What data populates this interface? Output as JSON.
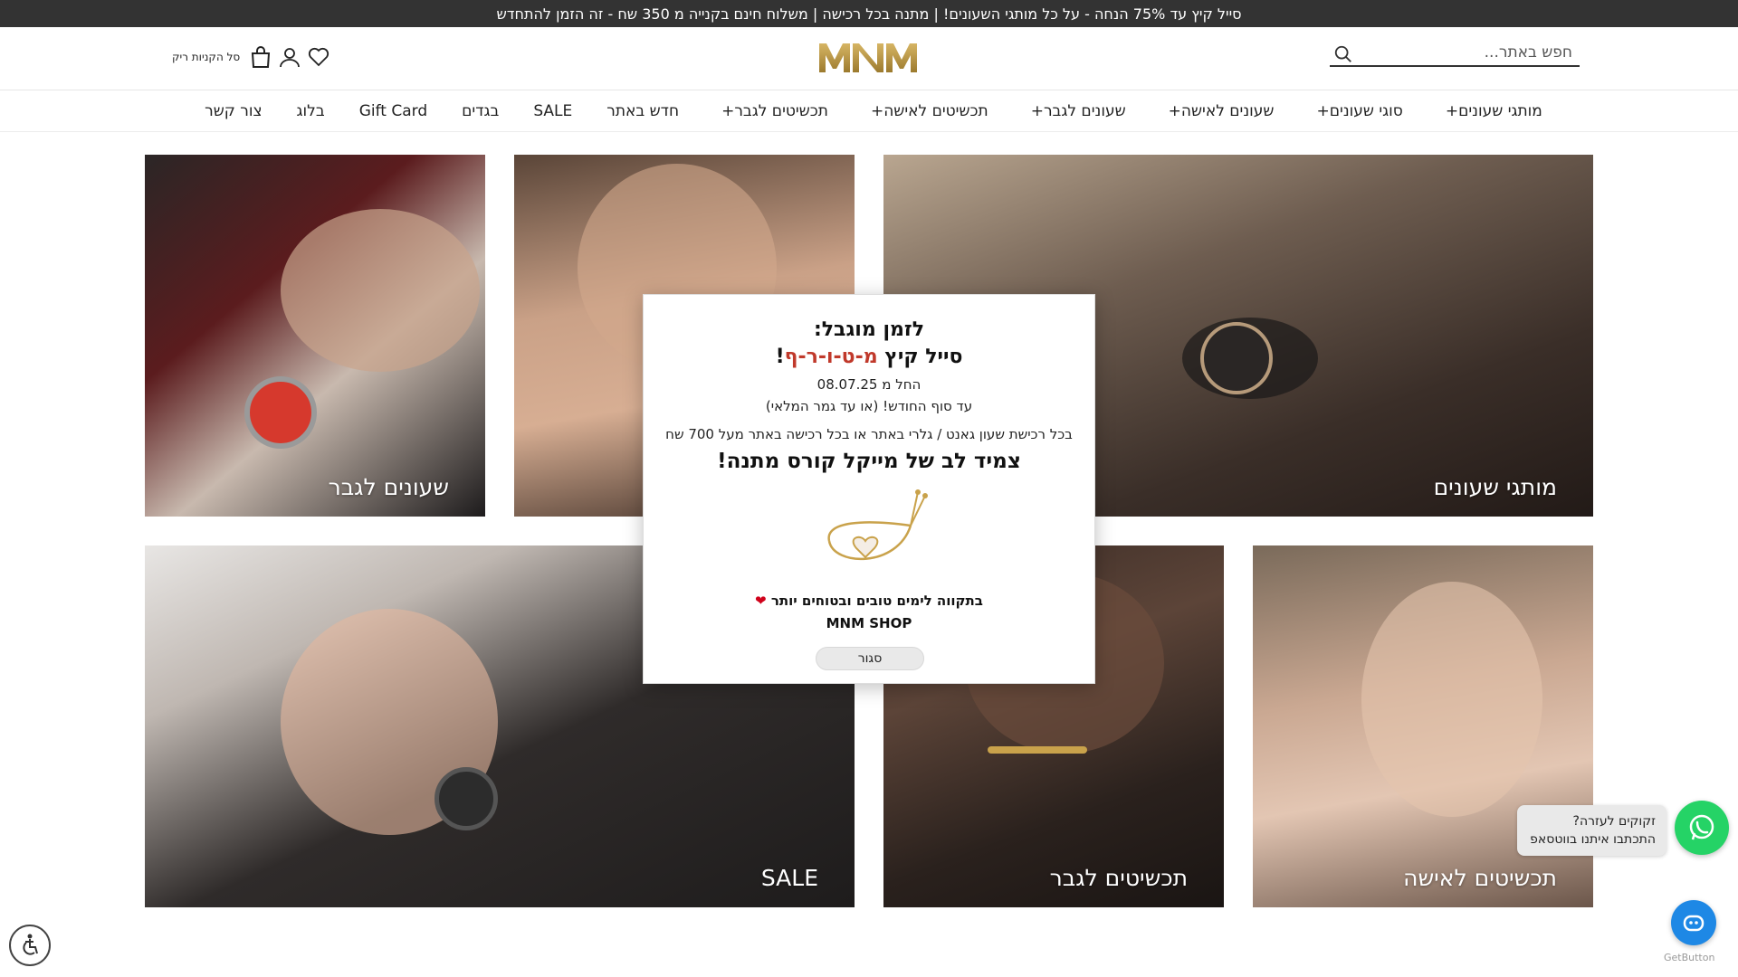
{
  "announcement": "סייל קיץ עד 75% הנחה - על כל מותגי השעונים! | מתנה בכל רכישה | משלוח חינם בקנייה מ 350 שח - זה הזמן להתחדש",
  "header": {
    "search_placeholder": "חפש באתר...",
    "logo_text": "MNM",
    "cart_text": "סל הקניות ריק"
  },
  "nav": {
    "items": [
      {
        "label": "מותגי שעונים",
        "has_plus": true
      },
      {
        "label": "סוגי שעונים",
        "has_plus": true
      },
      {
        "label": "שעונים לאישה",
        "has_plus": true
      },
      {
        "label": "שעונים לגבר",
        "has_plus": true
      },
      {
        "label": "תכשיטים לאישה",
        "has_plus": true
      },
      {
        "label": "תכשיטים לגבר",
        "has_plus": true
      },
      {
        "label": "חדש באתר",
        "has_plus": false
      },
      {
        "label": "SALE",
        "has_plus": false
      },
      {
        "label": "בגדים",
        "has_plus": false
      },
      {
        "label": "Gift Card",
        "has_plus": false
      },
      {
        "label": "בלוג",
        "has_plus": false
      },
      {
        "label": "צור קשר",
        "has_plus": false
      }
    ]
  },
  "tiles": {
    "brands": "מותגי שעונים",
    "women_watches": "",
    "men_watches": "שעונים לגבר",
    "women_jewelry": "תכשיטים לאישה",
    "men_jewelry": "תכשיטים לגבר",
    "sale": "SALE"
  },
  "modal": {
    "line1": "לזמן מוגבל:",
    "line2_prefix": "סייל קיץ ",
    "line2_accent": "מ-ט-ו-ר-ף",
    "line2_suffix": "!",
    "line3": "החל מ 08.07.25",
    "line4": "עד סוף החודש! (או עד גמר המלאי)",
    "line5": "בכל רכישת שעון גאנט / גלרי באתר או בכל רכישה באתר מעל 700 שח",
    "line6": "צמיד לב של מייקל קורס מתנה!",
    "line7": "בתקווה לימים טובים ובטוחים יותר",
    "line8": "MNM SHOP",
    "close_label": "סגור"
  },
  "whatsapp": {
    "line1": "זקוקים לעזרה?",
    "line2": "התכתבו איתנו בווטסאפ"
  },
  "getbutton": "GetButton",
  "colors": {
    "announce_bg": "#333333",
    "logo_gold": "#b8943f",
    "accent_red": "#c0392b",
    "whatsapp_green": "#25d366",
    "bot_blue": "#1e88e5"
  },
  "icons": [
    "search-icon",
    "heart-icon",
    "user-icon",
    "bag-icon",
    "whatsapp-icon",
    "chatbot-icon",
    "accessibility-icon",
    "bracelet-image"
  ]
}
